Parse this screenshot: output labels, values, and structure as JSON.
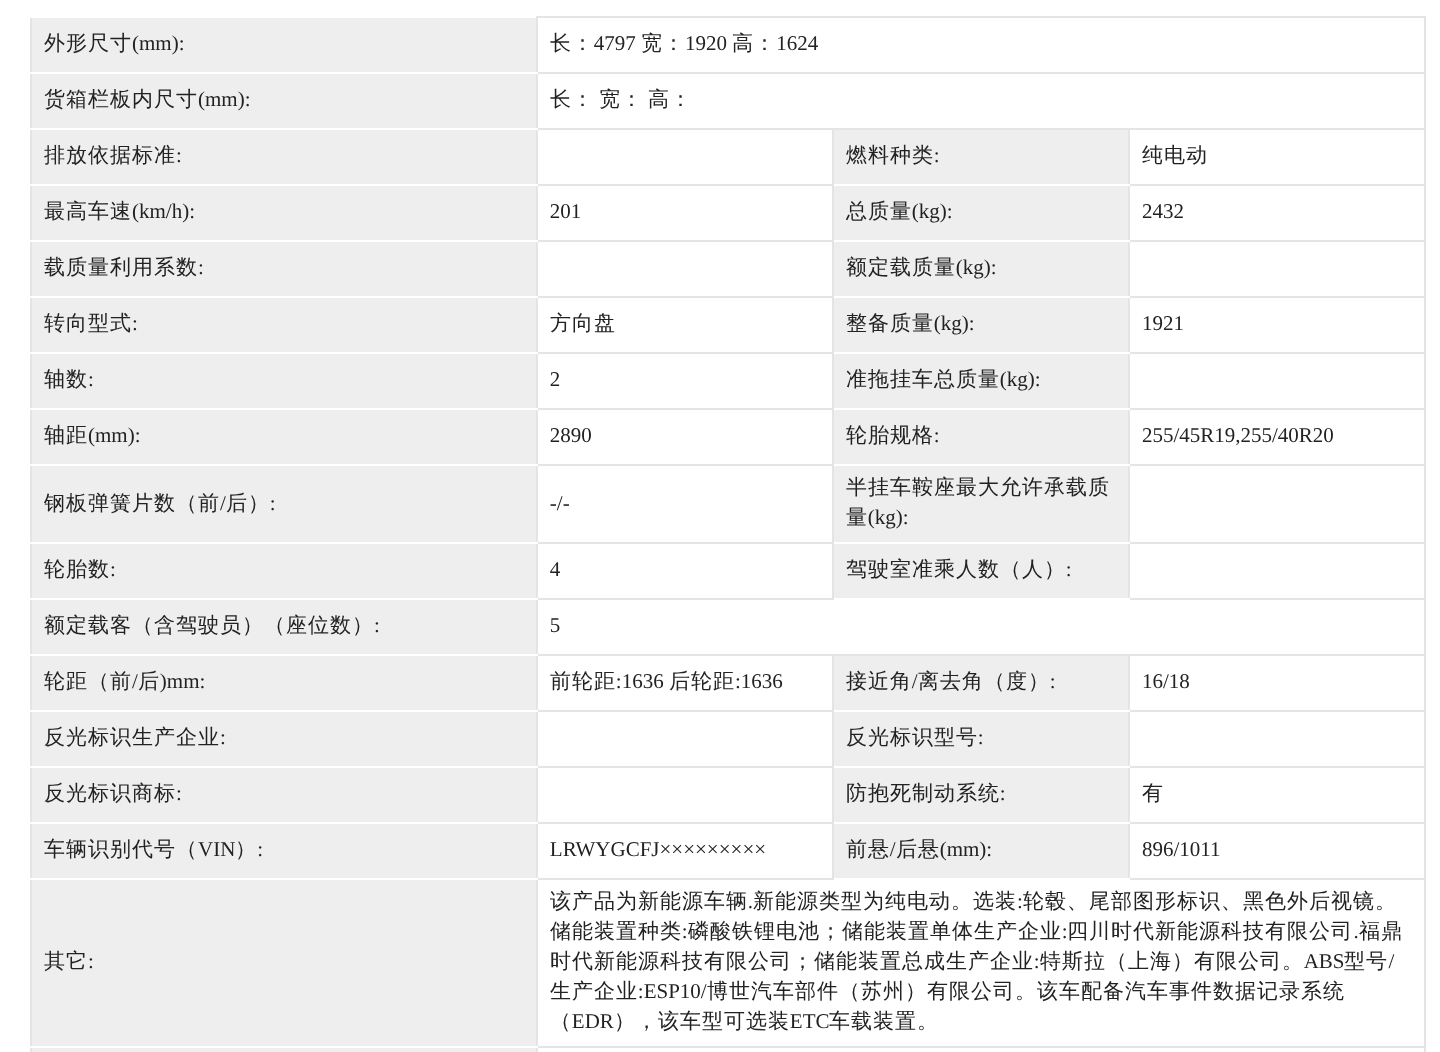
{
  "rows": [
    {
      "kind": "full",
      "label": "外形尺寸(mm):",
      "value": "长：4797 宽：1920 高：1624"
    },
    {
      "kind": "full",
      "label": "货箱栏板内尺寸(mm):",
      "value": "长：  宽：  高："
    },
    {
      "kind": "pair",
      "label": "排放依据标准:",
      "label2": "燃料种类:",
      "value2": "纯电动"
    },
    {
      "kind": "pair",
      "label": "最高车速(km/h):",
      "value": "201",
      "label2": "总质量(kg):",
      "value2": "2432"
    },
    {
      "kind": "pair",
      "label": "载质量利用系数:",
      "label2": "额定载质量(kg):"
    },
    {
      "kind": "pair",
      "label": "转向型式:",
      "value": "方向盘",
      "label2": "整备质量(kg):",
      "value2": "1921"
    },
    {
      "kind": "pair",
      "label": "轴数:",
      "value": "2",
      "label2": "准拖挂车总质量(kg):"
    },
    {
      "kind": "pair",
      "label": "轴距(mm):",
      "value": "2890",
      "label2": "轮胎规格:",
      "value2": "255/45R19,255/40R20"
    },
    {
      "kind": "pair",
      "label": "钢板弹簧片数（前/后）:",
      "value": "-/-",
      "label2": "半挂车鞍座最大允许承载质量(kg):"
    },
    {
      "kind": "pair",
      "label": "轮胎数:",
      "value": "4",
      "label2": "驾驶室准乘人数（人）:"
    },
    {
      "kind": "full",
      "label": "额定载客（含驾驶员）（座位数）:",
      "value": "5"
    },
    {
      "kind": "pair",
      "label": "轮距（前/后)mm:",
      "value": "前轮距:1636 后轮距:1636",
      "label2": "接近角/离去角（度）:",
      "value2": "16/18"
    },
    {
      "kind": "pair",
      "label": "反光标识生产企业:",
      "label2": "反光标识型号:"
    },
    {
      "kind": "pair",
      "label": "反光标识商标:",
      "label2": "防抱死制动系统:",
      "value2": "有"
    },
    {
      "kind": "pair",
      "label": "车辆识别代号（VIN）:",
      "value": "LRWYGCFJ×××××××××",
      "label2": "前悬/后悬(mm):",
      "value2": "896/1011"
    },
    {
      "kind": "full",
      "label": "其它:",
      "value": "该产品为新能源车辆.新能源类型为纯电动。选装:轮毂、尾部图形标识、黑色外后视镜。储能装置种类:磷酸铁锂电池；储能装置单体生产企业:四川时代新能源科技有限公司.福鼎时代新能源科技有限公司；储能装置总成生产企业:特斯拉（上海）有限公司。ABS型号/生产企业:ESP10/博世汽车部件（苏州）有限公司。该车配备汽车事件数据记录系统（EDR），该车型可选装ETC车载装置。"
    }
  ]
}
